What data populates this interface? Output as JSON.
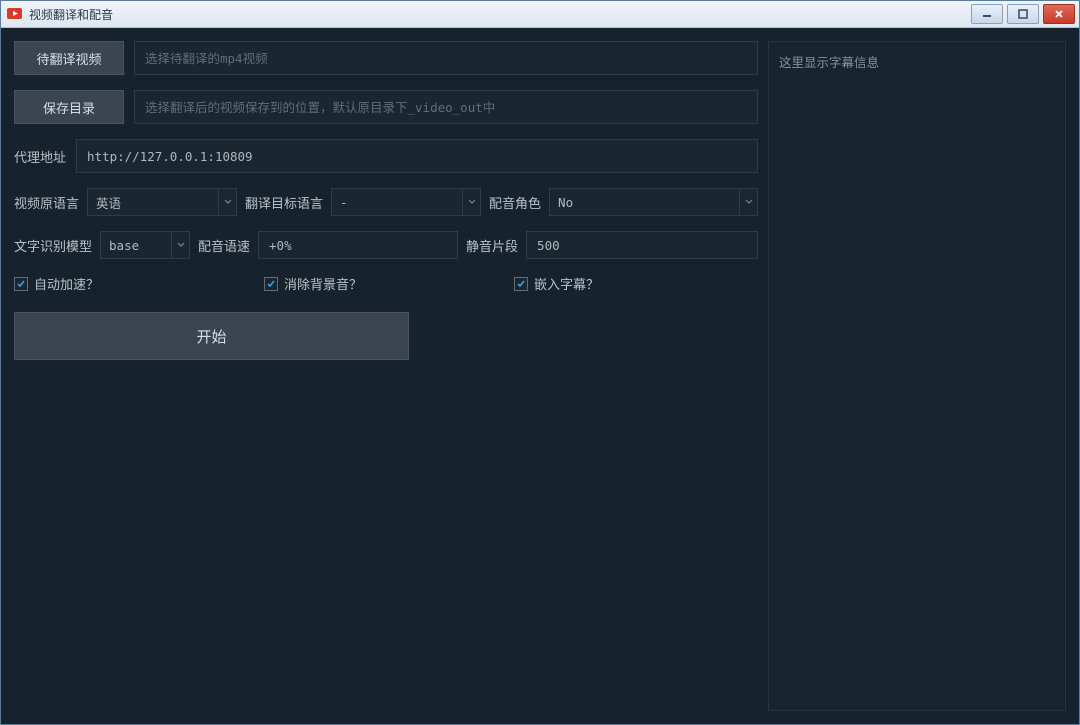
{
  "window": {
    "title": "视频翻译和配音"
  },
  "sourceVideo": {
    "button": "待翻译视频",
    "placeholder": "选择待翻译的mp4视频"
  },
  "saveDir": {
    "button": "保存目录",
    "placeholder": "选择翻译后的视频保存到的位置，默认原目录下_video_out中"
  },
  "proxy": {
    "label": "代理地址",
    "value": "http://127.0.0.1:10809"
  },
  "sourceLang": {
    "label": "视频原语言",
    "value": "英语"
  },
  "targetLang": {
    "label": "翻译目标语言",
    "value": "-"
  },
  "voiceRole": {
    "label": "配音角色",
    "value": "No"
  },
  "recogModel": {
    "label": "文字识别模型",
    "value": "base"
  },
  "voiceRate": {
    "label": "配音语速",
    "value": "+0%"
  },
  "silence": {
    "label": "静音片段",
    "value": "500"
  },
  "autoAccel": {
    "label": "自动加速？",
    "checked": true
  },
  "removeBg": {
    "label": "消除背景音？",
    "checked": true
  },
  "embedSub": {
    "label": "嵌入字幕？",
    "checked": true
  },
  "startButton": "开始",
  "subtitlePanel": {
    "placeholder": "这里显示字幕信息"
  }
}
